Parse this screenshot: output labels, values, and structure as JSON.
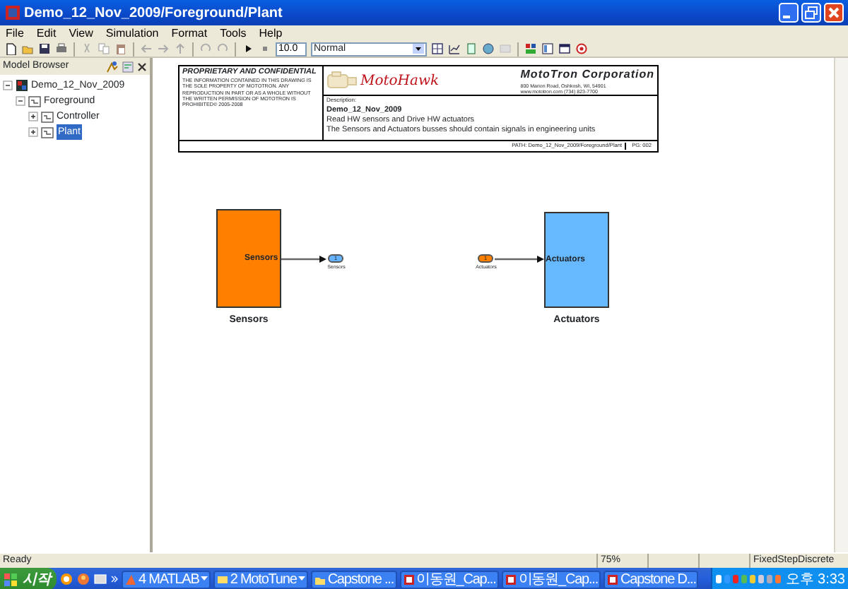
{
  "window": {
    "title": "Demo_12_Nov_2009/Foreground/Plant"
  },
  "menu": [
    {
      "label": "File"
    },
    {
      "label": "Edit"
    },
    {
      "label": "View"
    },
    {
      "label": "Simulation"
    },
    {
      "label": "Format"
    },
    {
      "label": "Tools"
    },
    {
      "label": "Help"
    }
  ],
  "toolbar": {
    "stop_time": "10.0",
    "mode": "Normal"
  },
  "model_browser": {
    "title": "Model Browser",
    "tree": [
      {
        "label": "Demo_12_Nov_2009",
        "expanded": true,
        "selected": false,
        "children": [
          {
            "label": "Foreground",
            "expanded": true,
            "selected": false,
            "children": [
              {
                "label": "Controller",
                "expanded": false,
                "selected": false
              },
              {
                "label": "Plant",
                "expanded": false,
                "selected": true
              }
            ]
          }
        ]
      }
    ]
  },
  "title_block": {
    "heading": "PROPRIETARY AND CONFIDENTIAL",
    "notice": "THE INFORMATION CONTAINED IN THIS DRAWING IS THE SOLE PROPERTY OF MOTOTRON. ANY REPRODUCTION IN PART OR AS A WHOLE WITHOUT THE WRITTEN PERMISSION OF MOTOTRON IS PROHIBITED© 2005-2008",
    "logo": "MotoHawk",
    "company": "MotoTron Corporation",
    "address": "800 Marion Road, Oshkosh, WI, 54901",
    "contact": "www.mototron.com (734) 823-7700",
    "description_label": "Description:",
    "model": "Demo_12_Nov_2009",
    "line_1": "Read HW sensors and Drive HW actuators",
    "line_2": "The Sensors and Actuators busses should contain signals in engineering units",
    "path": "PATH: Demo_12_Nov_2009/Foreground/Plant",
    "page": "PG: 002"
  },
  "diagram": {
    "items": [
      {
        "kind": "subsystem",
        "label": "Sensors",
        "port_label": "Sensors",
        "color": "#ff8000"
      },
      {
        "kind": "outport",
        "number": "1",
        "label": "Sensors",
        "color": "#66b3ff"
      },
      {
        "kind": "inport",
        "number": "1",
        "label": "Actuators",
        "color": "#ff8000"
      },
      {
        "kind": "subsystem",
        "label": "Actuators",
        "port_label": "Actuators",
        "color": "#66b8ff"
      }
    ]
  },
  "status_bar": {
    "message": "Ready",
    "zoom": "75%",
    "solver": "FixedStepDiscrete"
  },
  "taskbar": {
    "start": "시작",
    "items": [
      {
        "label": "4 MATLAB",
        "grouped": true
      },
      {
        "label": "2 MotoTune",
        "grouped": true
      },
      {
        "label": "Capstone ...",
        "grouped": false
      },
      {
        "label": "이동원_Cap...",
        "grouped": false
      },
      {
        "label": "이동원_Cap...",
        "grouped": false
      },
      {
        "label": "Capstone D...",
        "grouped": false
      }
    ],
    "clock": "오후 3:33"
  }
}
